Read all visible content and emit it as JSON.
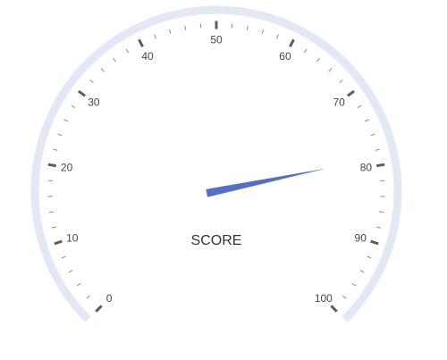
{
  "chart_data": {
    "type": "gauge",
    "title": "SCORE",
    "min": 0,
    "max": 100,
    "value": 79,
    "major_ticks": [
      0,
      10,
      20,
      30,
      40,
      50,
      60,
      70,
      80,
      90,
      100
    ],
    "minor_ticks_per_major": 5,
    "colors": {
      "axis": "#e3e8f7",
      "pointer": "#5470c6",
      "tick": "#5b5d66",
      "label": "#464646",
      "title": "#333333"
    }
  }
}
